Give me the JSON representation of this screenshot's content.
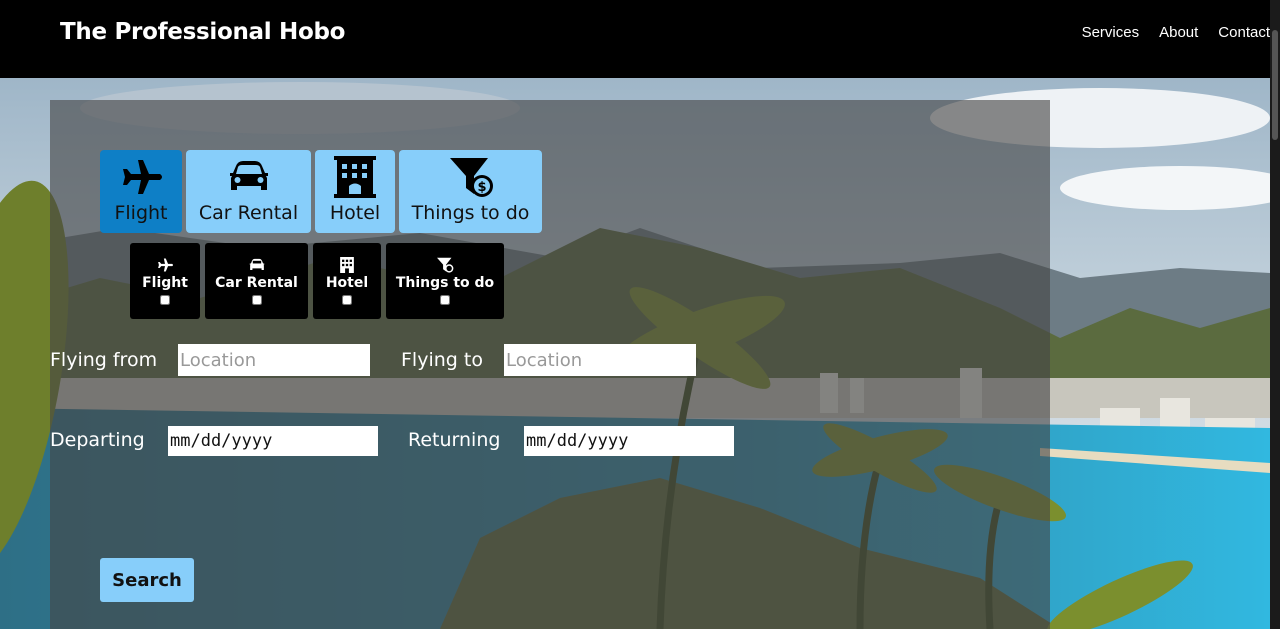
{
  "header": {
    "brand": "The Professional Hobo",
    "nav": [
      "Services",
      "About",
      "Contact"
    ]
  },
  "booking": {
    "category_tabs": [
      {
        "label": "Flight",
        "icon": "plane-icon",
        "active": true
      },
      {
        "label": "Car Rental",
        "icon": "car-icon",
        "active": false
      },
      {
        "label": "Hotel",
        "icon": "hotel-icon",
        "active": false
      },
      {
        "label": "Things to do",
        "icon": "funnel-dollar-icon",
        "active": false
      }
    ],
    "checkbox_tabs": [
      {
        "label": "Flight",
        "icon": "plane-icon",
        "checked": false
      },
      {
        "label": "Car Rental",
        "icon": "car-icon",
        "checked": false
      },
      {
        "label": "Hotel",
        "icon": "hotel-icon",
        "checked": false
      },
      {
        "label": "Things to do",
        "icon": "funnel-dollar-icon",
        "checked": false
      }
    ],
    "flying_from": {
      "label": "Flying from",
      "placeholder": "Location",
      "value": ""
    },
    "flying_to": {
      "label": "Flying to",
      "placeholder": "Location",
      "value": ""
    },
    "departing": {
      "label": "Departing",
      "value": "mm/dd/yyyy"
    },
    "returning": {
      "label": "Returning",
      "value": "mm/dd/yyyy"
    },
    "search_label": "Search"
  },
  "colors": {
    "tab_light": "#87cefa",
    "tab_active": "#0e7fc6",
    "header_bg": "#000000"
  }
}
